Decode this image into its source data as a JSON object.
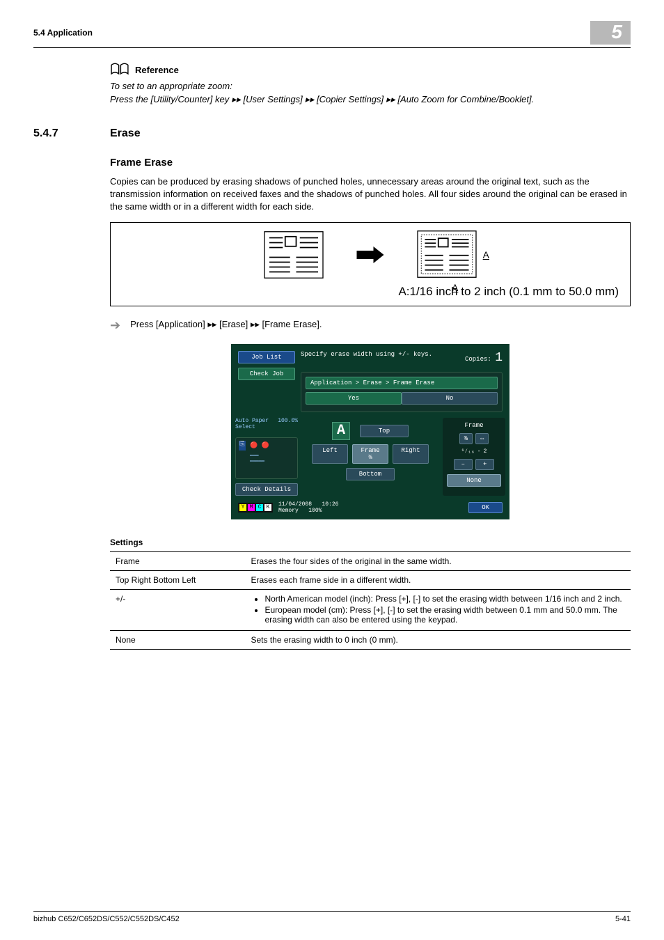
{
  "header": {
    "section_left": "5.4    Application",
    "chapter_number": "5"
  },
  "reference": {
    "label": "Reference",
    "line1": "To set to an appropriate zoom:",
    "line2": "Press the [Utility/Counter] key ▸▸ [User Settings] ▸▸ [Copier Settings] ▸▸ [Auto Zoom for Combine/Booklet]."
  },
  "section": {
    "number": "5.4.7",
    "title": "Erase",
    "subtitle": "Frame Erase",
    "body": "Copies can be produced by erasing shadows of punched holes, unnecessary areas around the original text, such as the transmission information on received faxes and the shadows of punched holes. All four sides around the original can be erased in the same width or in a different width for each side."
  },
  "diagram": {
    "caption": "A:1/16 inch to 2 inch (0.1 mm to 50.0 mm)",
    "marker_right": "A",
    "marker_bottom": "A"
  },
  "instruction": {
    "text": "Press [Application] ▸▸ [Erase] ▸▸ [Frame Erase]."
  },
  "screenshot": {
    "job_list": "Job List",
    "check_job": "Check Job",
    "top_hint": "Specify erase width using +/- keys.",
    "copies_label": "Copies:",
    "copies_value": "1",
    "breadcrumb": "Application > Erase > Frame Erase",
    "tab_yes": "Yes",
    "tab_no": "No",
    "auto_paper": "Auto Paper Select",
    "percent": "100.0%",
    "check_details": "Check Details",
    "letter": "A",
    "btn_top": "Top",
    "btn_left": "Left",
    "btn_frame": "Frame",
    "frame_val": "⅜",
    "btn_right": "Right",
    "btn_bottom": "Bottom",
    "side_frame": "Frame",
    "side_val1": "⅜",
    "side_swap": "⇔",
    "side_val2": "¹⁄₁₆",
    "side_dash": "-",
    "side_val3": "2",
    "side_minus": "–",
    "side_plus": "+",
    "side_none": "None",
    "date": "11/04/2008",
    "time": "10:26",
    "memory": "Memory",
    "mem_val": "100%",
    "ok": "OK",
    "y": "Y",
    "m": "M",
    "c": "C",
    "k": "K"
  },
  "settings": {
    "heading": "Settings",
    "rows": {
      "r0": {
        "label": "Frame",
        "desc": "Erases the four sides of the original in the same width."
      },
      "r1": {
        "label": "Top Right Bottom Left",
        "desc": "Erases each frame side in a different width."
      },
      "r2": {
        "label": "+/-",
        "b1": "North American model (inch): Press [+], [-] to set the erasing width between 1/16 inch and 2 inch.",
        "b2": "European model (cm): Press [+], [-] to set the erasing width between 0.1 mm and 50.0 mm. The erasing width can also be entered using the keypad."
      },
      "r3": {
        "label": "None",
        "desc": "Sets the erasing width to 0 inch (0 mm)."
      }
    }
  },
  "footer": {
    "model": "bizhub C652/C652DS/C552/C552DS/C452",
    "page": "5-41"
  }
}
